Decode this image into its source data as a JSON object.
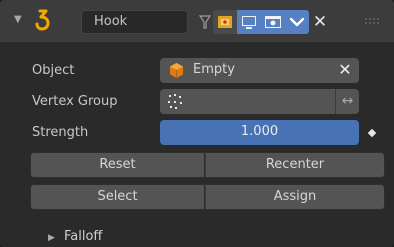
{
  "modifier": {
    "name_value": "Hook",
    "icons": [
      "disclosure-triangle-icon",
      "hook-modifier-icon",
      "funnel-icon",
      "edit-mode-icon",
      "realtime-viewport-icon",
      "render-icon",
      "chevron-down-icon",
      "close-icon",
      "drag-handle-icon"
    ]
  },
  "fields": {
    "object_label": "Object",
    "object_value": "Empty",
    "vertex_group_label": "Vertex Group",
    "vertex_group_value": "",
    "strength_label": "Strength",
    "strength_value": "1.000"
  },
  "buttons": {
    "reset": "Reset",
    "recenter": "Recenter",
    "select": "Select",
    "assign": "Assign"
  },
  "subpanel": {
    "falloff_label": "Falloff"
  },
  "colors": {
    "accent_blue": "#5680c2",
    "slider_blue": "#4772b3",
    "hook_orange": "#f5a800"
  }
}
